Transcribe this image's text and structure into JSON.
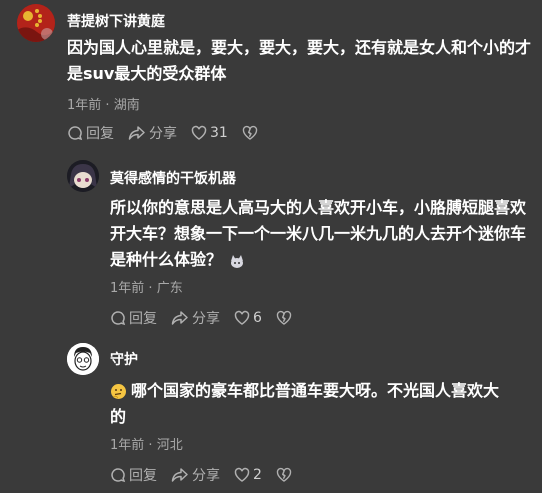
{
  "comments": [
    {
      "username": "菩提树下讲黄庭",
      "avatar_icon": "red-flag-avatar",
      "text": "因为国人心里就是，要大，要大，要大，还有就是女人和个小的才是suv最大的受众群体",
      "time": "1年前",
      "location": "湖南",
      "reply_label": "回复",
      "share_label": "分享",
      "likes": "31"
    },
    {
      "username": "莫得感情的干饭机器",
      "avatar_icon": "anime-avatar",
      "text": "所以你的意思是人高马大的人喜欢开小车，小胳膊短腿喜欢开大车？想象一下一个一米八几一米九几的人去开个迷你车是种什么体验？",
      "time": "1年前",
      "location": "广东",
      "reply_label": "回复",
      "share_label": "分享",
      "likes": "6"
    },
    {
      "username": "守护",
      "avatar_icon": "cartoon-face-avatar",
      "text": "哪个国家的豪车都比普通车要大呀。不光国人喜欢大的",
      "time": "1年前",
      "location": "河北",
      "reply_label": "回复",
      "share_label": "分享",
      "likes": "2"
    }
  ],
  "separator": "·",
  "colors": {
    "background": "#3a3a3a",
    "text": "#ffffff",
    "meta": "#a8a8a8"
  }
}
